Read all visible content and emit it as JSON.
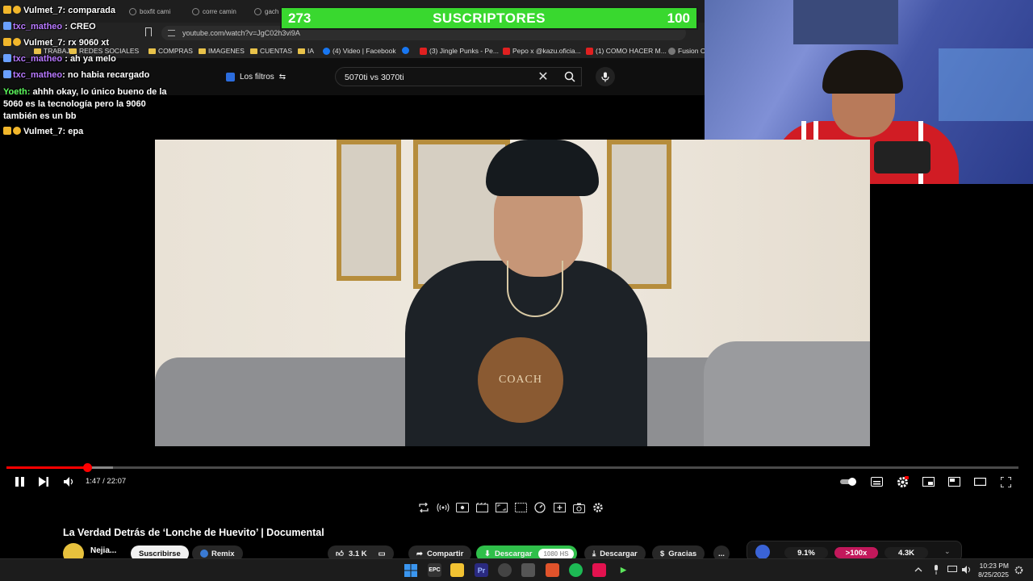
{
  "browser": {
    "tabs": [
      "boxfit cami",
      "corre camin",
      "gach"
    ],
    "url": "youtube.com/watch?v=JgC02h3vi9A",
    "bookmarks": [
      "TRABAJO",
      "REDES SOCIALES",
      "COMPRAS",
      "IMAGENES",
      "CUENTAS",
      "IA",
      "(4) Video | Facebook",
      "(3) Jingle Punks - Pe...",
      "Pepo x @kazu.oficia...",
      "(1) COMO HACER M...",
      "Fusion Cl"
    ]
  },
  "youtube_header": {
    "filters_label": "Los filtros",
    "search_value": "5070ti vs 3070ti"
  },
  "sub_goal": {
    "current": "273",
    "label": "SUSCRIPTORES",
    "goal": "100",
    "bar_color": "#39d82f"
  },
  "chat": [
    {
      "user": "Vulmet_7",
      "sep": ":",
      "text": "comparada"
    },
    {
      "user": "txc_matheo",
      "sep": ":",
      "text": "CREO"
    },
    {
      "user": "Vulmet_7",
      "sep": ":",
      "text": "rx 9060 xt"
    },
    {
      "user": "txc_matheo",
      "sep": ":",
      "text": "ah ya melo"
    },
    {
      "user": "txc_matheo",
      "sep": ":",
      "text": "no habia recargado"
    },
    {
      "user": "Yoeth",
      "sep": ":",
      "text": "ahhh okay, lo único bueno de la"
    },
    {
      "user": "",
      "sep": "",
      "text": "5060 es la tecnología pero la 9060"
    },
    {
      "user": "",
      "sep": "",
      "text": "también es un bb"
    },
    {
      "user": "Vulmet_7",
      "sep": ":",
      "text": "epa"
    }
  ],
  "video": {
    "shirt_logo": "COACH",
    "time_current": "1:47",
    "time_total": "22:07",
    "played_fraction": 0.08,
    "loaded_fraction": 0.105
  },
  "video_info": {
    "title": "La Verdad Detrás de ‘Lonche de Huevito’ | Documental",
    "channel": "Nejia...",
    "subscribe_label": "Suscribirse",
    "remix_label": "Remix",
    "likes": "3.1 K",
    "share_label": "Compartir",
    "download_label": "Descargar",
    "download_quality": "1080 HS",
    "download2_label": "Descargar",
    "thanks_label": "Gracias",
    "more_label": "...",
    "stats": [
      "9.1%",
      ">100x",
      "4.3K"
    ]
  },
  "taskbar": {
    "time": "10:23 PM",
    "date": "8/25/2025"
  },
  "colors": {
    "accent_red": "#ff0000",
    "chat_name_purple": "#b879ff",
    "chat_name_green": "#5dff5d"
  }
}
